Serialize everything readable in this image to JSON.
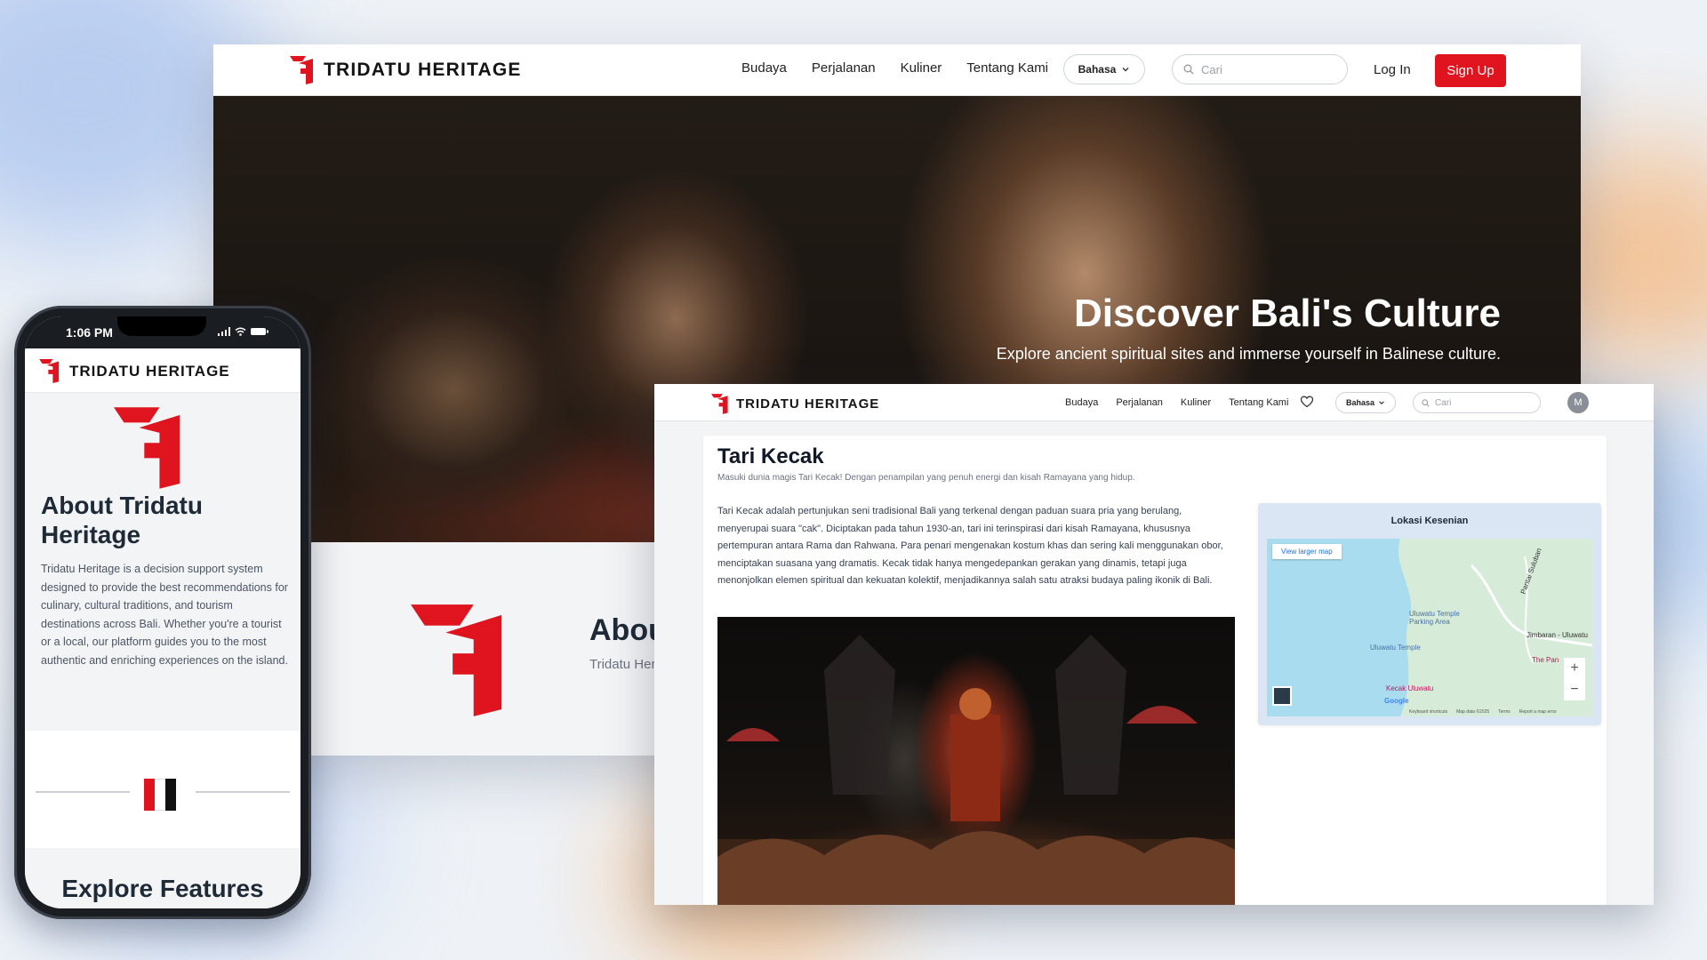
{
  "desktop": {
    "brand": "TRIDATU HERITAGE",
    "nav_links": [
      "Budaya",
      "Perjalanan",
      "Kuliner",
      "Tentang Kami"
    ],
    "language_button": "Bahasa",
    "search_placeholder": "Cari",
    "login_label": "Log In",
    "signup_label": "Sign Up",
    "hero_title": "Discover Bali's Culture",
    "hero_subtitle": "Explore ancient spiritual sites and immerse yourself in Balinese culture.",
    "about_title": "Abou",
    "about_text": "Tridatu Heri destinations island."
  },
  "detail": {
    "brand": "TRIDATU HERITAGE",
    "nav_links": [
      "Budaya",
      "Perjalanan",
      "Kuliner",
      "Tentang Kami"
    ],
    "language_button": "Bahasa",
    "search_placeholder": "Cari",
    "avatar_initial": "M",
    "title": "Tari Kecak",
    "subtitle": "Masuki dunia magis Tari Kecak! Dengan penampilan yang penuh energi dan kisah Ramayana yang hidup.",
    "body": "Tari Kecak adalah pertunjukan seni tradisional Bali yang terkenal dengan paduan suara pria yang berulang, menyerupai suara \"cak\". Diciptakan pada tahun 1930-an, tari ini terinspirasi dari kisah Ramayana, khususnya pertempuran antara Rama dan Rahwana. Para penari mengenakan kostum khas dan sering kali menggunakan obor, menciptakan suasana yang dramatis. Kecak tidak hanya mengedepankan gerakan yang dinamis, tetapi juga menonjolkan elemen spiritual dan kekuatan kolektif, menjadikannya salah satu atraksi budaya paling ikonik di Bali.",
    "map": {
      "title": "Lokasi Kesenian",
      "view_larger": "View larger map",
      "labels": {
        "parking": "Uluwatu Temple Parking Area",
        "temple": "Uluwatu Temple",
        "kecak": "Kecak Uluwatu",
        "road": "Jimbaran - Uluwatu",
        "pantai": "Pantai Suluban",
        "pan": "The Pan"
      },
      "zoom_in": "+",
      "zoom_out": "−",
      "footer": [
        "Keyboard shortcuts",
        "Map data ©2025",
        "Terms",
        "Report a map error"
      ],
      "google": "Google"
    }
  },
  "mobile": {
    "time": "1:06 PM",
    "brand": "TRIDATU HERITAGE",
    "about_title": "About Tridatu Heritage",
    "about_text": "Tridatu Heritage is a decision support system designed to provide the best recommendations for culinary, cultural traditions, and tourism destinations across Bali. Whether you're a tourist or a local, our platform guides you to the most authentic and enriching experiences on the island.",
    "explore_title": "Explore Features"
  },
  "colors": {
    "brand_red": "#e0141e",
    "dark_text": "#1f2a37",
    "muted_text": "#6b7280"
  }
}
